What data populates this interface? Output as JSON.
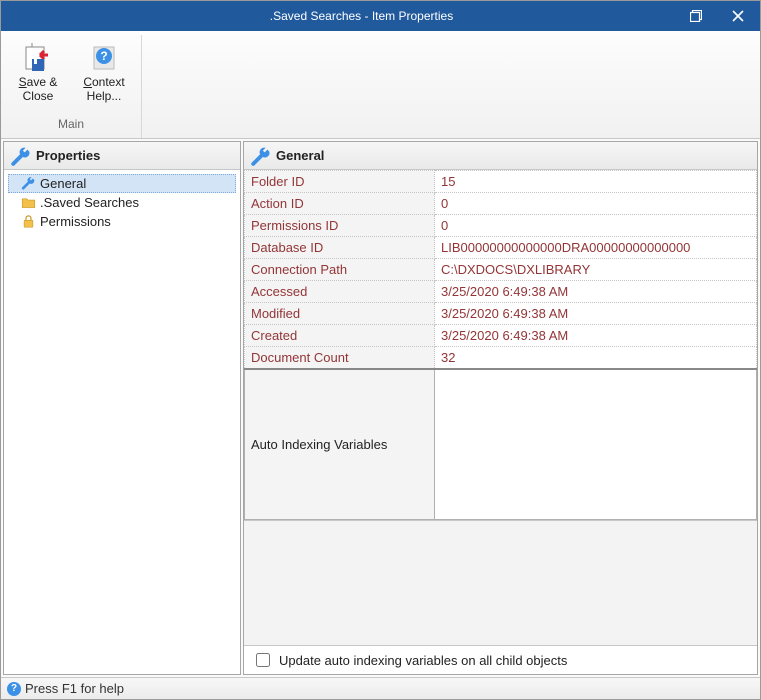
{
  "titlebar": {
    "title": ".Saved Searches - Item Properties"
  },
  "ribbon": {
    "save_close_label": "Save & Close",
    "context_help_label": "Context Help...",
    "group_label": "Main"
  },
  "left_panel": {
    "header": "Properties",
    "items": [
      {
        "label": "General",
        "icon": "wrench",
        "selected": true
      },
      {
        "label": ".Saved Searches",
        "icon": "folder",
        "selected": false
      },
      {
        "label": "Permissions",
        "icon": "lock",
        "selected": false
      }
    ]
  },
  "right_panel": {
    "header": "General",
    "rows": [
      {
        "label": "Folder ID",
        "value": "15"
      },
      {
        "label": "Action ID",
        "value": "0"
      },
      {
        "label": "Permissions ID",
        "value": "0"
      },
      {
        "label": "Database ID",
        "value": "LIB00000000000000DRA00000000000000"
      },
      {
        "label": "Connection Path",
        "value": "C:\\DXDOCS\\DXLIBRARY"
      },
      {
        "label": "Accessed",
        "value": "3/25/2020 6:49:38 AM"
      },
      {
        "label": "Modified",
        "value": "3/25/2020 6:49:38 AM"
      },
      {
        "label": "Created",
        "value": "3/25/2020 6:49:38 AM"
      },
      {
        "label": "Document Count",
        "value": "32"
      }
    ],
    "auto_index_label": "Auto Indexing Variables",
    "checkbox_label": "Update auto indexing variables on all child objects",
    "checkbox_checked": false
  },
  "statusbar": {
    "text": "Press F1 for help"
  }
}
